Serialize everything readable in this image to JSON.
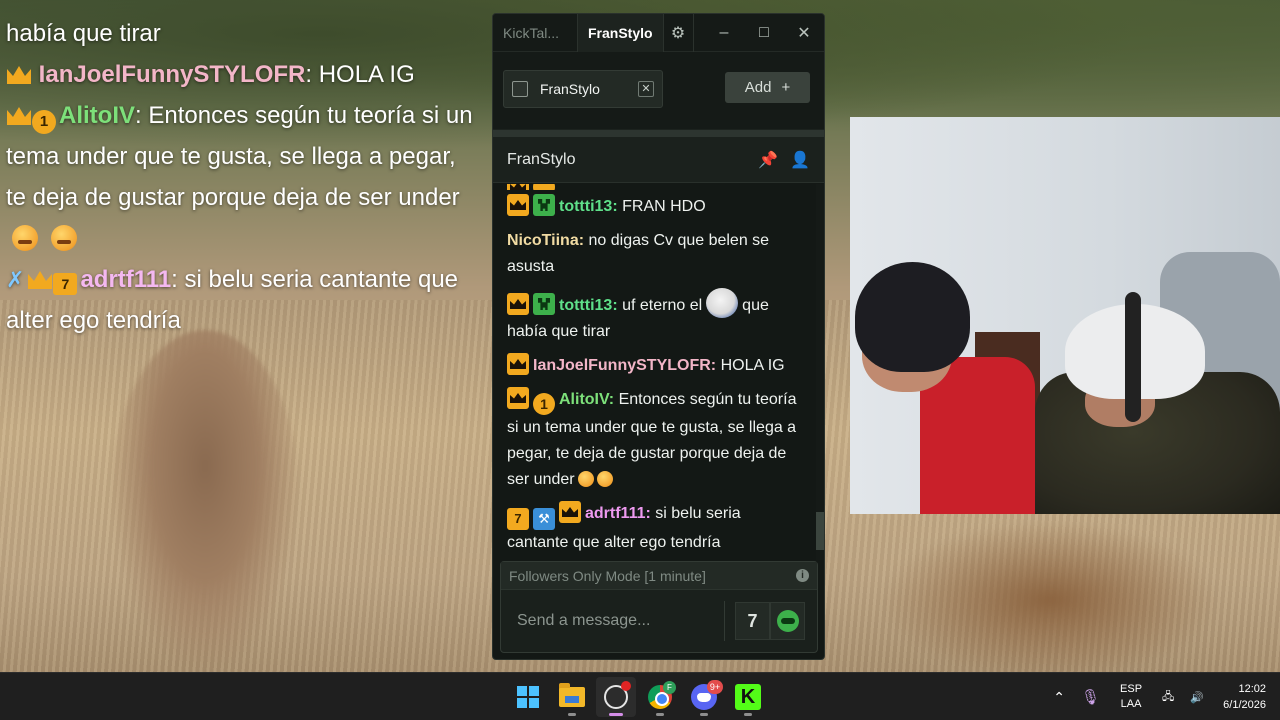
{
  "overlay_chat": {
    "messages": [
      {
        "text_line1": "había que tirar"
      },
      {
        "user": "IanJoelFunnySTYLOFR",
        "text": "HOLA IG",
        "user_color": "#f3b6c8"
      },
      {
        "user": "AlitoIV",
        "text": "Entonces según tu teoría si un tema under que te gusta, se llega a pegar, te deja de gustar porque deja de ser under",
        "user_color": "#7de07a",
        "badge_number": "1"
      },
      {
        "user": "adrtf111",
        "text": "si belu seria cantante que alter ego tendría",
        "user_color": "#f4b8f0",
        "badge_seven": "7"
      }
    ]
  },
  "kicktalk": {
    "title_tab_inactive": "KickTal...",
    "title_tab_active": "FranStylo",
    "window_controls": {
      "minimize": "–",
      "maximize": "□",
      "close": "✕"
    },
    "channel_tab": {
      "name": "FranStylo",
      "close": "✕"
    },
    "add_button": "Add",
    "add_plus": "+",
    "channel_header": "FranStylo",
    "messages": [
      {
        "user": "tottti13",
        "text": "FRAN HDO",
        "user_color": "#5fe08a"
      },
      {
        "user": "NicoTiina",
        "text": "no digas Cv que belen se asusta",
        "user_color": "#f1dba3"
      },
      {
        "user": "tottti13",
        "text_before_emote": "uf eterno el",
        "text_after_emote": "que había que tirar",
        "user_color": "#5fe08a"
      },
      {
        "user": "IanJoelFunnySTYLOFR",
        "text": "HOLA IG",
        "user_color": "#f3b6c8"
      },
      {
        "user": "AlitoIV",
        "text": "Entonces según tu teoría si un tema under que te gusta, se llega a pegar, te deja de gustar porque deja de ser under",
        "user_color": "#7de07a",
        "badge_number": "1"
      },
      {
        "user": "adrtf111",
        "text": "si belu seria cantante que alter ego tendría",
        "user_color": "#ee9af0",
        "badge_seven": "7"
      }
    ],
    "followers_mode": "Followers Only Mode [1 minute]",
    "input_placeholder": "Send a message...",
    "emote_button": "7"
  },
  "taskbar": {
    "apps": [
      "windows-start",
      "file-explorer",
      "obs-studio",
      "chrome",
      "discord",
      "kick"
    ],
    "chrome_badge": "F",
    "discord_badge": "9+",
    "language_line1": "ESP",
    "language_line2": "LAA",
    "time": "12:02",
    "date": "6/1/2026"
  },
  "colors": {
    "accent_kick": "#53fc18",
    "crown_badge": "#f2a91f",
    "window_bg": "#131815"
  }
}
